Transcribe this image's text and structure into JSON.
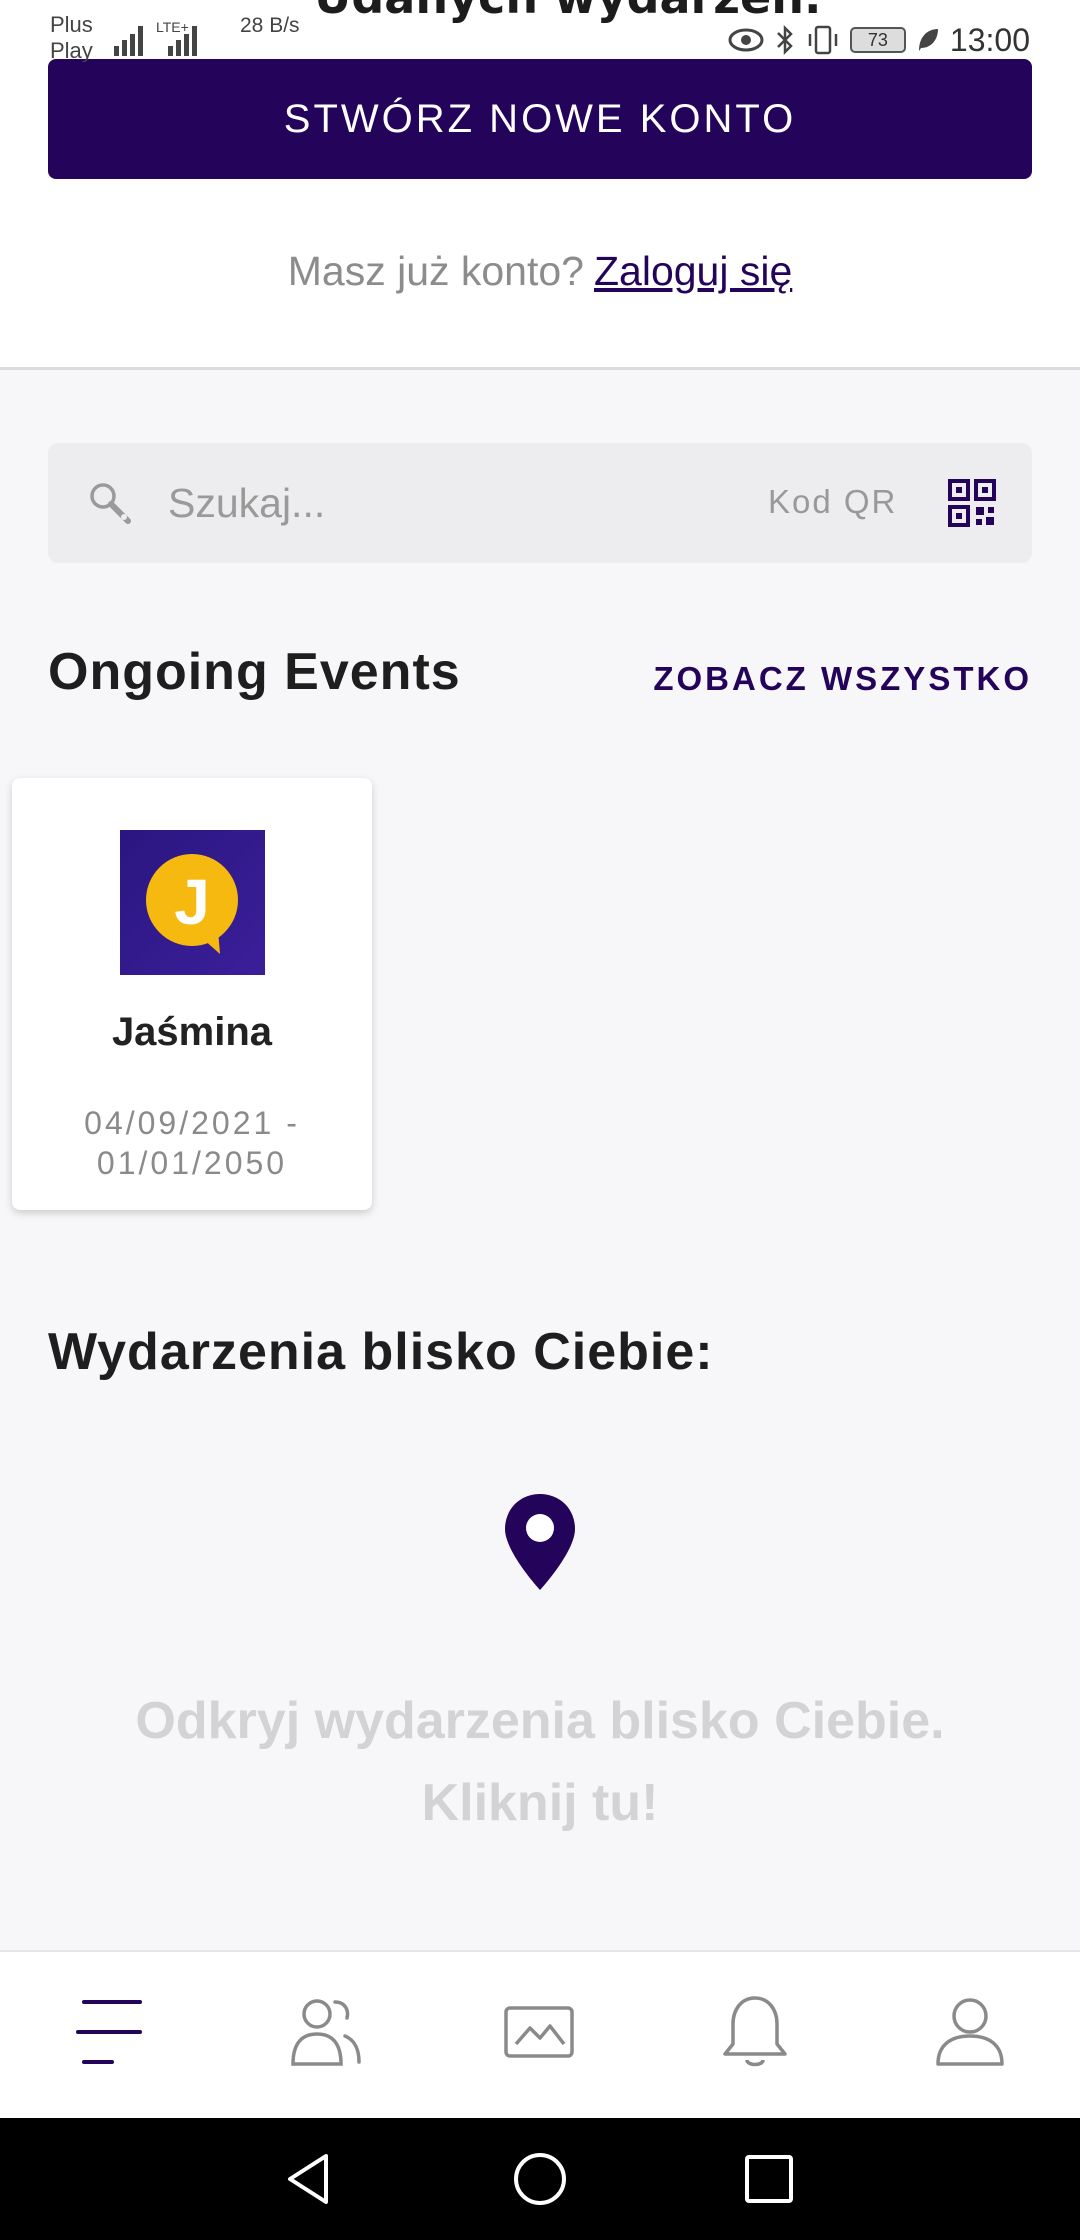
{
  "status_bar": {
    "peek_title": "Udanych wydarzeń.",
    "carrier": "Plus Play",
    "net_type": "LTE+",
    "net_speed": "28 B/s",
    "battery": "73",
    "time": "13:00"
  },
  "account": {
    "create_button": "STWÓRZ NOWE KONTO",
    "login_prompt": "Masz już konto?",
    "login_link": "Zaloguj się"
  },
  "search": {
    "placeholder": "Szukaj...",
    "qr_label": "Kod QR"
  },
  "ongoing": {
    "title": "Ongoing Events",
    "see_all": "ZOBACZ WSZYSTKO",
    "events": [
      {
        "name": "Jaśmina",
        "dates": "04/09/2021 - 01/01/2050",
        "logo_letter": "J"
      }
    ]
  },
  "nearby": {
    "title": "Wydarzenia blisko Ciebie:",
    "cta_line1": "Odkryj wydarzenia blisko Ciebie.",
    "cta_line2": "Kliknij tu!"
  },
  "bottom_nav": {
    "items": [
      "menu-icon",
      "people-icon",
      "gallery-icon",
      "bell-icon",
      "profile-icon"
    ]
  },
  "colors": {
    "brand": "#24045a",
    "accent_yellow": "#f6b90f",
    "background": "#f7f7f9"
  }
}
